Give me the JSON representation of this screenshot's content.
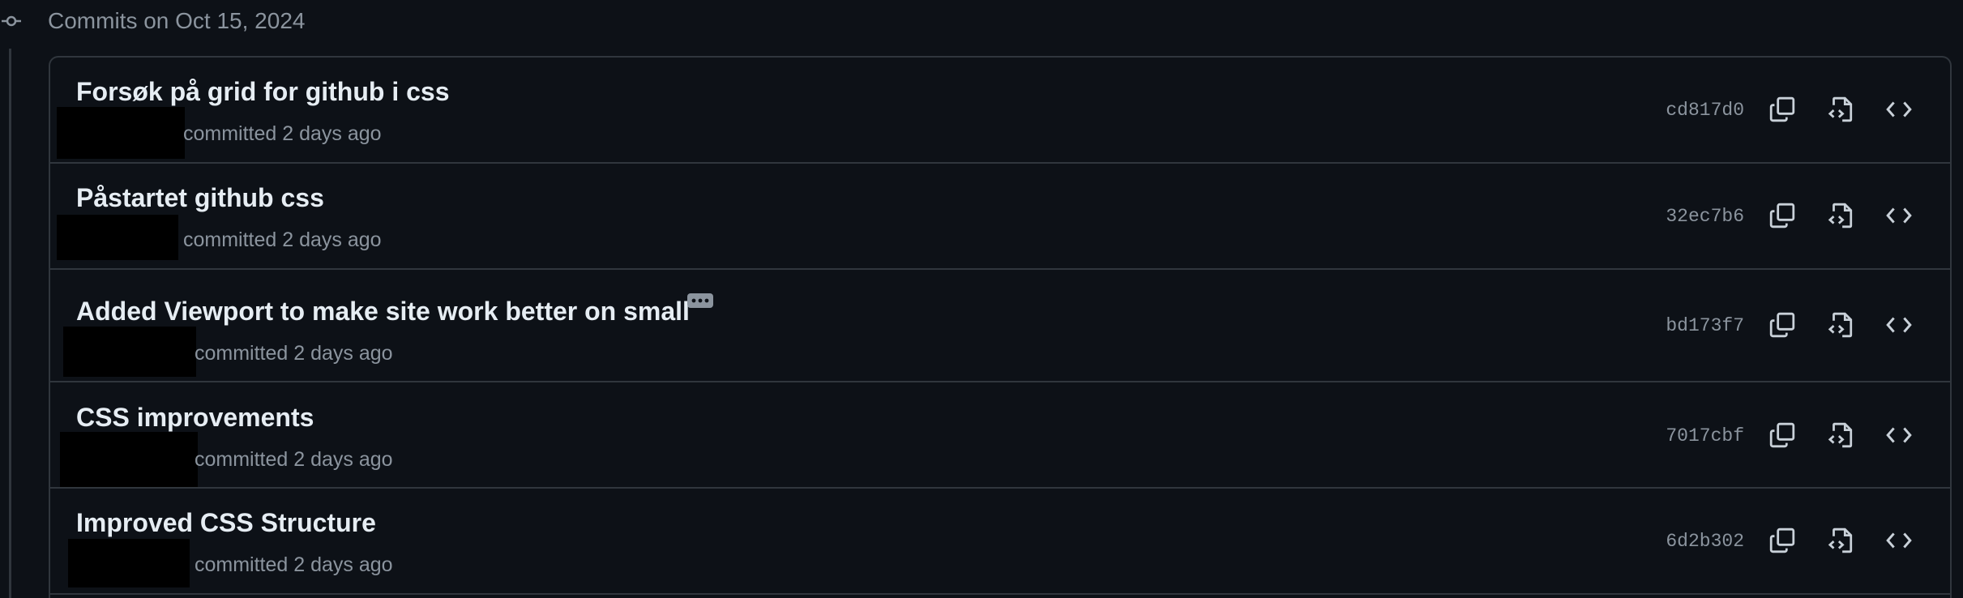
{
  "group": {
    "title": "Commits on Oct 15, 2024"
  },
  "commits": [
    {
      "message": "Forsøk på grid for github i css",
      "committed_text": "committed 2 days ago",
      "sha": "cd817d0"
    },
    {
      "message": "Påstartet github css",
      "committed_text": "committed 2 days ago",
      "sha": "32ec7b6"
    },
    {
      "message": "Added Viewport to make site work better on small",
      "committed_text": "committed 2 days ago",
      "sha": "bd173f7",
      "has_more_button": true
    },
    {
      "message": "CSS improvements",
      "committed_text": "committed 2 days ago",
      "sha": "7017cbf"
    },
    {
      "message": "Improved CSS Structure",
      "committed_text": "committed 2 days ago",
      "sha": "6d2b302"
    }
  ],
  "colors": {
    "background": "#0d1117",
    "border": "#30363d",
    "text_primary": "#e6edf3",
    "text_muted": "#8b949e"
  },
  "icons": {
    "group_marker": "git-commit-icon",
    "copy": "copy-icon",
    "browse_files": "file-code-icon",
    "browse_repo": "code-icon",
    "more": "ellipsis-icon"
  }
}
